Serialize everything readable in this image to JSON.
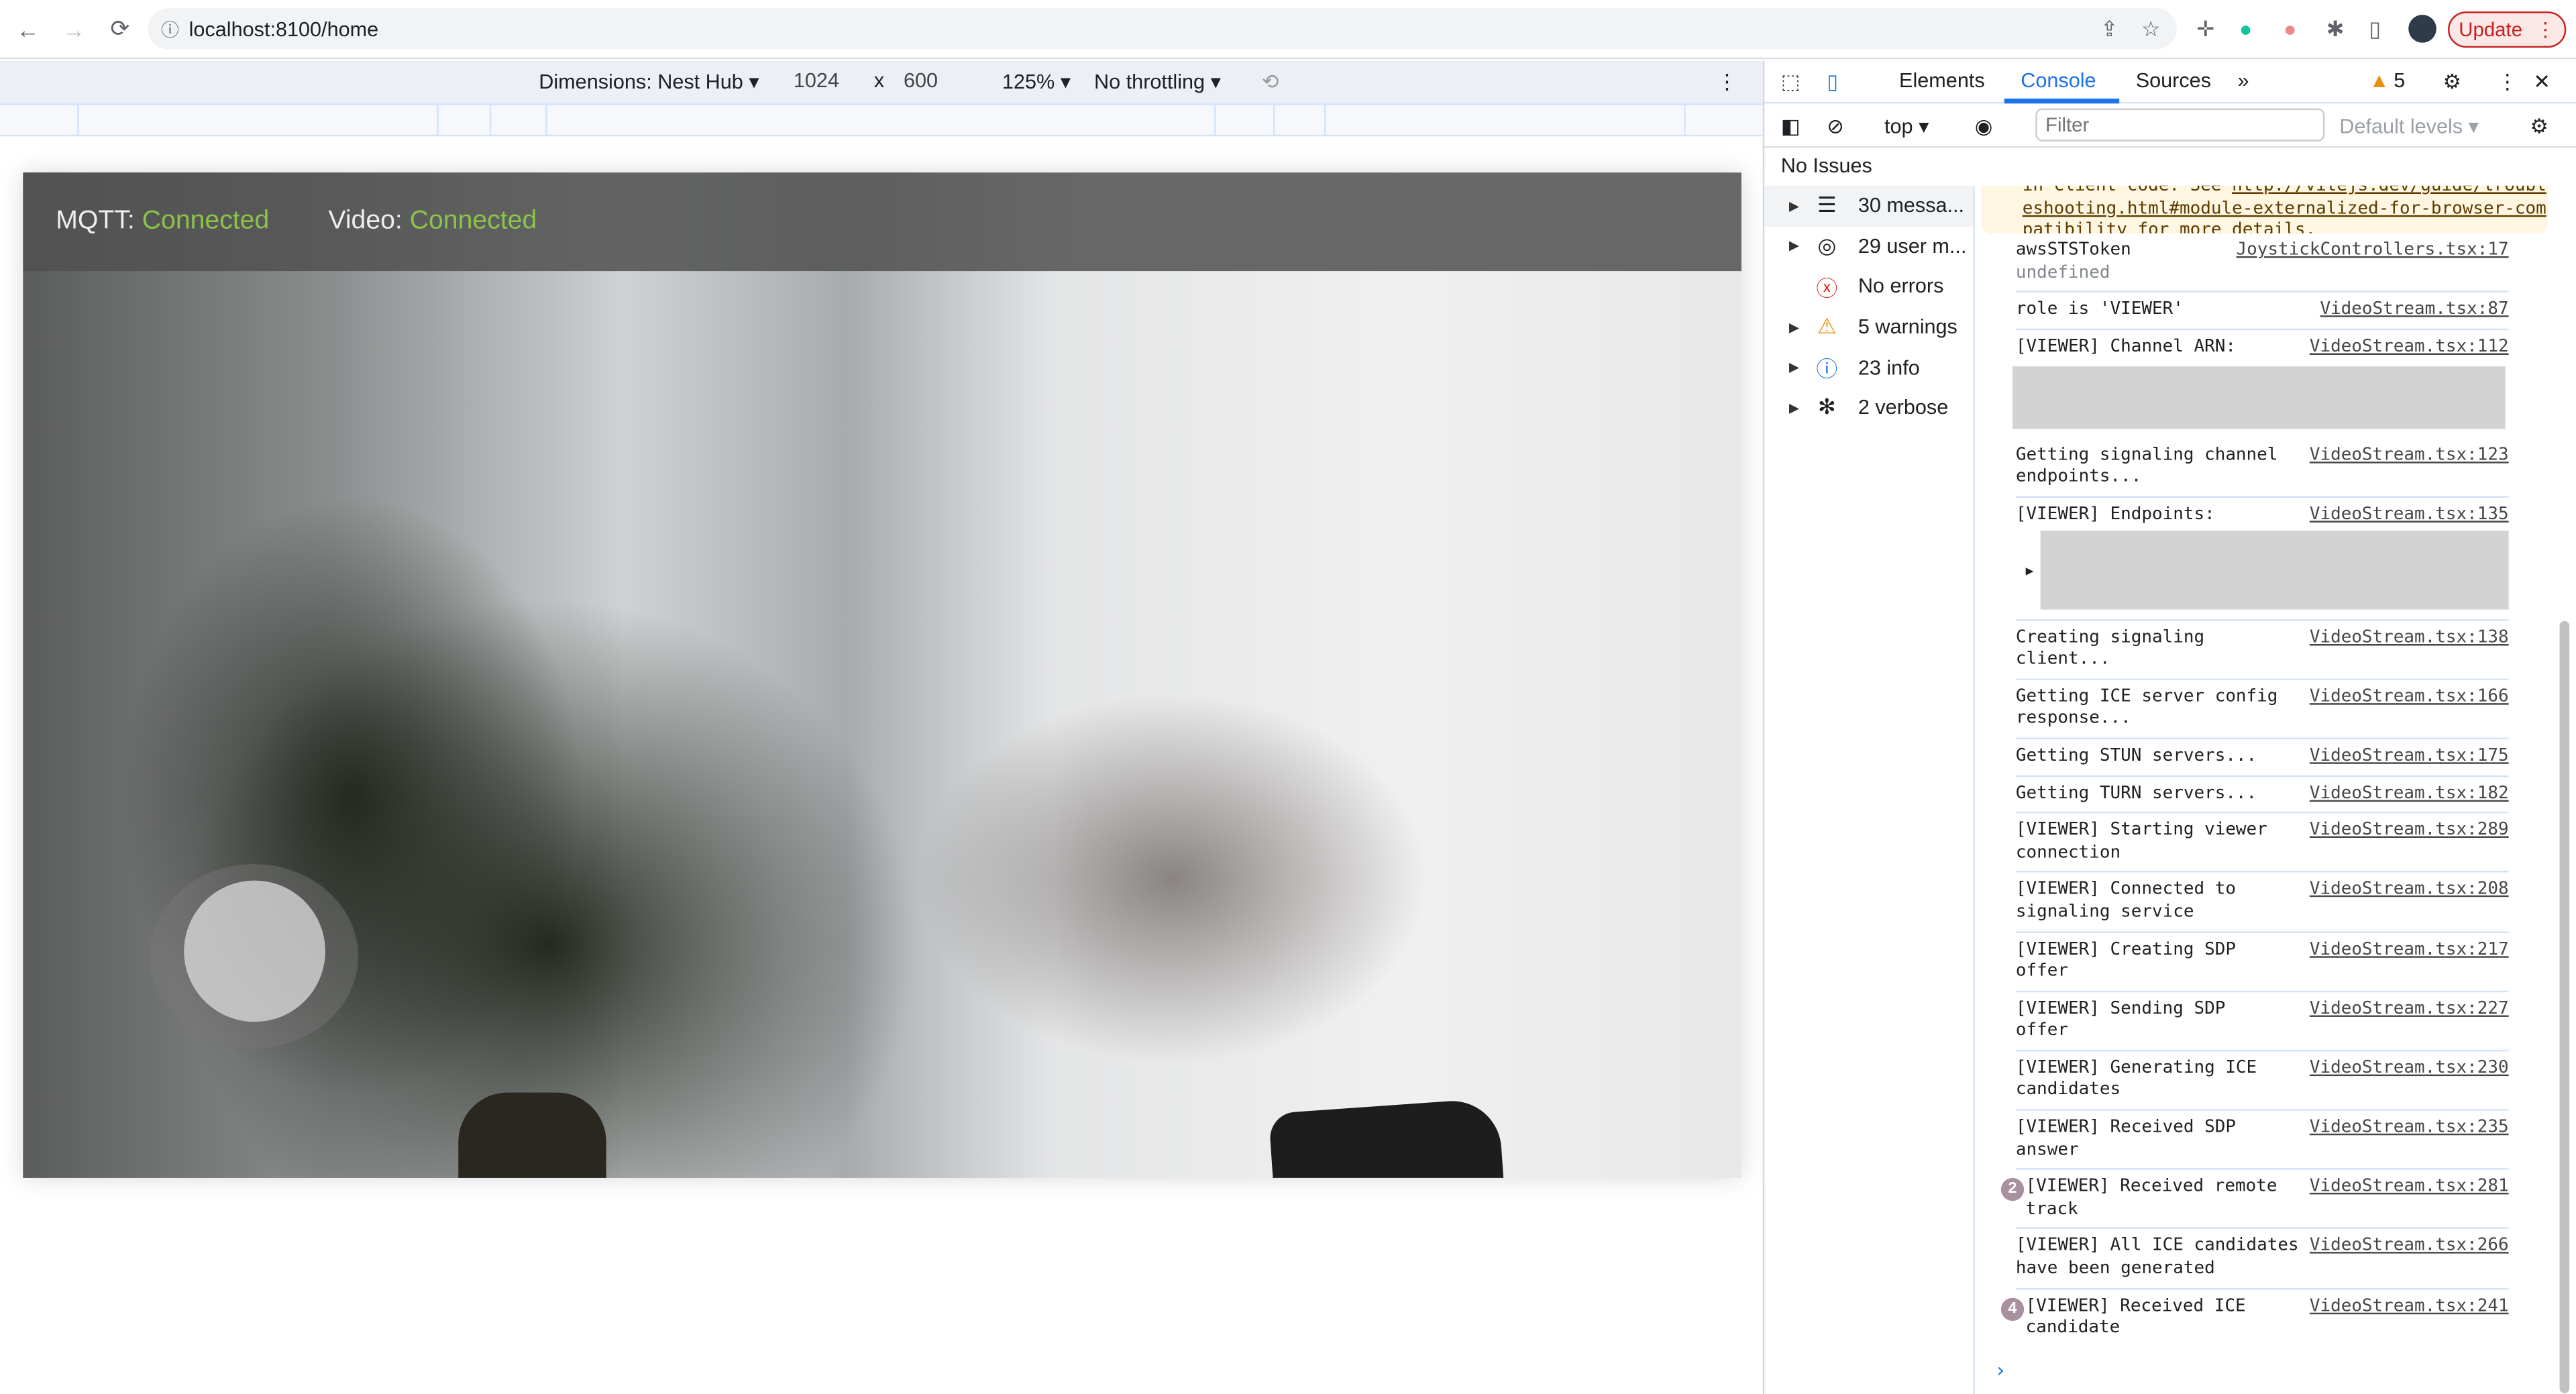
{
  "browser": {
    "url": "localhost:8100/home",
    "update_label": "Update",
    "nav": {
      "back": "←",
      "forward": "→",
      "reload": "⟳"
    }
  },
  "device_toolbar": {
    "dimensions": "Dimensions: Nest Hub ▾",
    "width": "1024",
    "x": "x",
    "height": "600",
    "zoom": "125% ▾",
    "throttling": "No throttling ▾"
  },
  "app": {
    "mqtt_label": "MQTT:",
    "mqtt_status": "Connected",
    "video_label": "Video:",
    "video_status": "Connected",
    "status_color": "#8bc34a"
  },
  "devtools": {
    "tabs": [
      "Elements",
      "Console",
      "Sources"
    ],
    "active_tab": "Console",
    "more": "»",
    "warning_count": "5",
    "context": "top ▾",
    "filter_placeholder": "Filter",
    "levels": "Default levels ▾",
    "issues": "No Issues",
    "sidebar": [
      {
        "label": "30 messa...",
        "icon": "list-icon"
      },
      {
        "label": "29 user m...",
        "icon": "user-icon"
      },
      {
        "label": "No errors",
        "icon": "error-icon"
      },
      {
        "label": "5 warnings",
        "icon": "warning-icon"
      },
      {
        "label": "23 info",
        "icon": "info-icon"
      },
      {
        "label": "2 verbose",
        "icon": "bug-icon"
      }
    ],
    "warning_text": {
      "pre": "in client code. See ",
      "link": "http://vitejs.dev/guide/troubleshooting.html#module-externalized-for-browser-compatibility",
      "post": " for more details."
    },
    "messages": [
      {
        "text": "awsSTSToken",
        "sub": "undefined",
        "source": "JoystickControllers.tsx:17"
      },
      {
        "text": "role is 'VIEWER'",
        "source": "VideoStream.tsx:87"
      },
      {
        "text": "[VIEWER] Channel ARN:",
        "source": "VideoStream.tsx:112"
      },
      {
        "text": "Getting signaling channel endpoints...",
        "source": "VideoStream.tsx:123"
      },
      {
        "text": "[VIEWER] Endpoints:",
        "source": "VideoStream.tsx:135"
      },
      {
        "text": "Creating signaling client...",
        "source": "VideoStream.tsx:138"
      },
      {
        "text": "Getting ICE server config response...",
        "source": "VideoStream.tsx:166"
      },
      {
        "text": "Getting STUN servers...",
        "source": "VideoStream.tsx:175"
      },
      {
        "text": "Getting TURN servers...",
        "source": "VideoStream.tsx:182"
      },
      {
        "text": "[VIEWER] Starting viewer connection",
        "source": "VideoStream.tsx:289"
      },
      {
        "text": "[VIEWER] Connected to signaling service",
        "source": "VideoStream.tsx:208"
      },
      {
        "text": "[VIEWER] Creating SDP offer",
        "source": "VideoStream.tsx:217"
      },
      {
        "text": "[VIEWER] Sending SDP offer",
        "source": "VideoStream.tsx:227"
      },
      {
        "text": "[VIEWER] Generating ICE candidates",
        "source": "VideoStream.tsx:230"
      },
      {
        "text": "[VIEWER] Received SDP answer",
        "source": "VideoStream.tsx:235"
      },
      {
        "text": "[VIEWER] Received remote track",
        "source": "VideoStream.tsx:281",
        "count": "2"
      },
      {
        "text": "[VIEWER] All ICE candidates have been generated",
        "source": "VideoStream.tsx:266"
      },
      {
        "text": "[VIEWER] Received ICE candidate",
        "source": "VideoStream.tsx:241",
        "count": "4"
      }
    ],
    "prompt": "›"
  }
}
